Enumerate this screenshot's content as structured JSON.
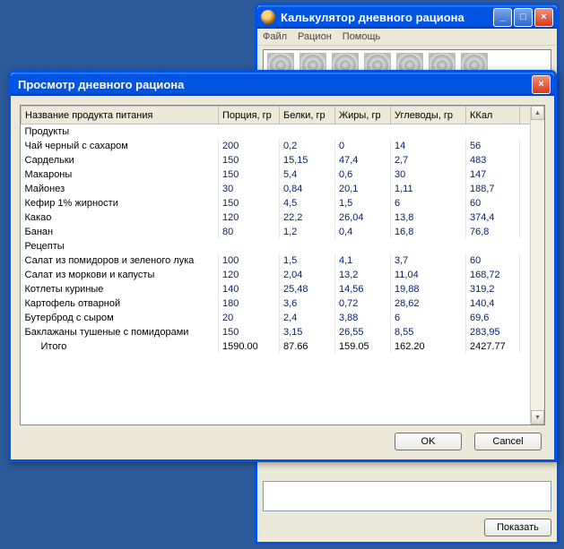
{
  "bg_window": {
    "title": "Калькулятор дневного рациона",
    "menu": [
      "Файл",
      "Рацион",
      "Помощь"
    ],
    "show_button": "Показать"
  },
  "dialog": {
    "title": "Просмотр дневного рациона",
    "columns": {
      "name": "Название продукта питания",
      "portion": "Порция, гр",
      "protein": "Белки, гр",
      "fat": "Жиры, гр",
      "carb": "Углеводы, гр",
      "kcal": "ККал"
    },
    "section1": "Продукты",
    "section2": "Рецепты",
    "products": [
      {
        "name": "Чай черный с сахаром",
        "portion": "200",
        "protein": "0,2",
        "fat": "0",
        "carb": "14",
        "kcal": "56"
      },
      {
        "name": "Сардельки",
        "portion": "150",
        "protein": "15,15",
        "fat": "47,4",
        "carb": "2,7",
        "kcal": "483"
      },
      {
        "name": "Макароны",
        "portion": "150",
        "protein": "5,4",
        "fat": "0,6",
        "carb": "30",
        "kcal": "147"
      },
      {
        "name": "Майонез",
        "portion": "30",
        "protein": "0,84",
        "fat": "20,1",
        "carb": "1,11",
        "kcal": "188,7"
      },
      {
        "name": "Кефир 1% жирности",
        "portion": "150",
        "protein": "4,5",
        "fat": "1,5",
        "carb": "6",
        "kcal": "60"
      },
      {
        "name": "Какао",
        "portion": "120",
        "protein": "22,2",
        "fat": "26,04",
        "carb": "13,8",
        "kcal": "374,4"
      },
      {
        "name": "Банан",
        "portion": "80",
        "protein": "1,2",
        "fat": "0,4",
        "carb": "16,8",
        "kcal": "76,8"
      }
    ],
    "recipes": [
      {
        "name": "Салат из помидоров и зеленого лука",
        "portion": "100",
        "protein": "1,5",
        "fat": "4,1",
        "carb": "3,7",
        "kcal": "60"
      },
      {
        "name": "Салат из моркови и капусты",
        "portion": "120",
        "protein": "2,04",
        "fat": "13,2",
        "carb": "11,04",
        "kcal": "168,72"
      },
      {
        "name": "Котлеты куриные",
        "portion": "140",
        "protein": "25,48",
        "fat": "14,56",
        "carb": "19,88",
        "kcal": "319,2"
      },
      {
        "name": "Картофель отварной",
        "portion": "180",
        "protein": "3,6",
        "fat": "0,72",
        "carb": "28,62",
        "kcal": "140,4"
      },
      {
        "name": "Бутерброд с сыром",
        "portion": "20",
        "protein": "2,4",
        "fat": "3,88",
        "carb": "6",
        "kcal": "69,6"
      },
      {
        "name": "Баклажаны тушеные с помидорами",
        "portion": "150",
        "protein": "3,15",
        "fat": "26,55",
        "carb": "8,55",
        "kcal": "283,95"
      }
    ],
    "totals": {
      "label": "Итого",
      "portion": "1590.00",
      "protein": "87.66",
      "fat": "159.05",
      "carb": "162.20",
      "kcal": "2427.77"
    },
    "ok": "OK",
    "cancel": "Cancel"
  }
}
